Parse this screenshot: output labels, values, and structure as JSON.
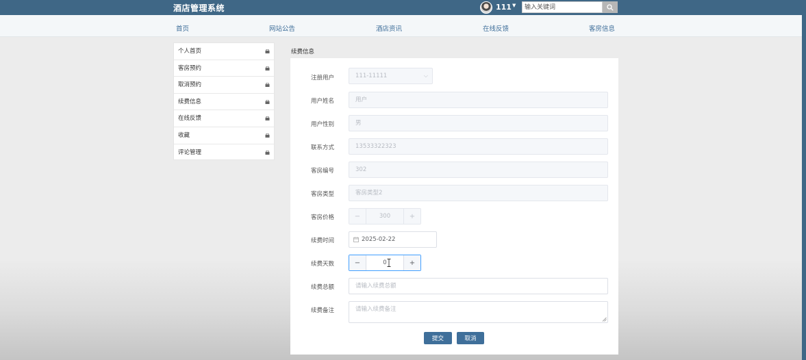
{
  "header": {
    "site_title": "酒店管理系统",
    "username": "111",
    "search_placeholder": "输入关键词"
  },
  "nav": {
    "items": [
      {
        "label": "首页"
      },
      {
        "label": "网站公告"
      },
      {
        "label": "酒店资讯"
      },
      {
        "label": "在线反馈"
      },
      {
        "label": "客房信息"
      }
    ]
  },
  "sidebar": {
    "items": [
      {
        "label": "个人首页"
      },
      {
        "label": "客房预约"
      },
      {
        "label": "取消预约"
      },
      {
        "label": "续费信息"
      },
      {
        "label": "在线反馈"
      },
      {
        "label": "收藏"
      },
      {
        "label": "评论管理"
      }
    ]
  },
  "form": {
    "title": "续费信息",
    "registered_user": {
      "label": "注册用户",
      "value": "111-11111"
    },
    "user_name": {
      "label": "用户姓名",
      "value": "用户"
    },
    "user_gender": {
      "label": "用户性别",
      "value": "男"
    },
    "contact": {
      "label": "联系方式",
      "value": "13533322323"
    },
    "room_number": {
      "label": "客房编号",
      "value": "302"
    },
    "room_type": {
      "label": "客房类型",
      "value": "客房类型2"
    },
    "room_price": {
      "label": "客房价格",
      "value": "300",
      "minus": "−",
      "plus": "+"
    },
    "renew_date": {
      "label": "续费时间",
      "value": "2025-02-22"
    },
    "renew_days": {
      "label": "续费天数",
      "value": "0",
      "minus": "−",
      "plus": "+"
    },
    "renew_total": {
      "label": "续费总额",
      "placeholder": "请输入续费总额"
    },
    "renew_note": {
      "label": "续费备注",
      "placeholder": "请输入续费备注"
    },
    "submit_label": "提交",
    "cancel_label": "取消"
  },
  "colors": {
    "header_bg": "#3f6786",
    "accent": "#3f6f9a",
    "focus": "#409eff"
  }
}
